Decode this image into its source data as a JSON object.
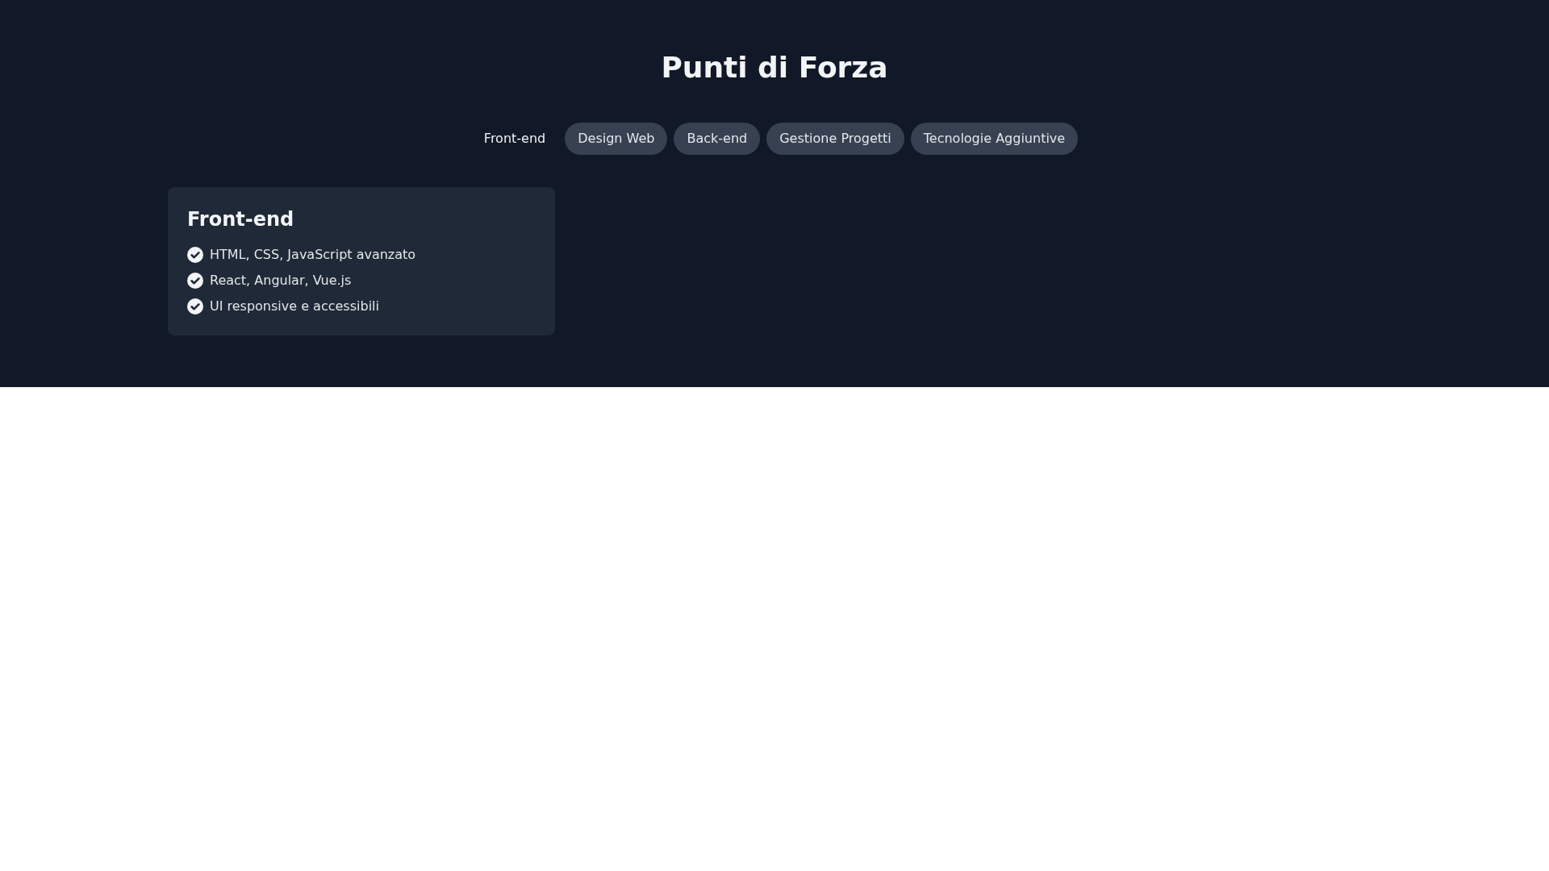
{
  "section": {
    "title": "Punti di Forza"
  },
  "tabs": [
    {
      "label": "Front-end",
      "selected": true
    },
    {
      "label": "Design Web",
      "selected": false
    },
    {
      "label": "Back-end",
      "selected": false
    },
    {
      "label": "Gestione Progetti",
      "selected": false
    },
    {
      "label": "Tecnologie Aggiuntive",
      "selected": false
    }
  ],
  "cards": [
    {
      "title": "Front-end",
      "items": [
        "HTML, CSS, JavaScript avanzato",
        "React, Angular, Vue.js",
        "UI responsive e accessibili"
      ]
    }
  ]
}
